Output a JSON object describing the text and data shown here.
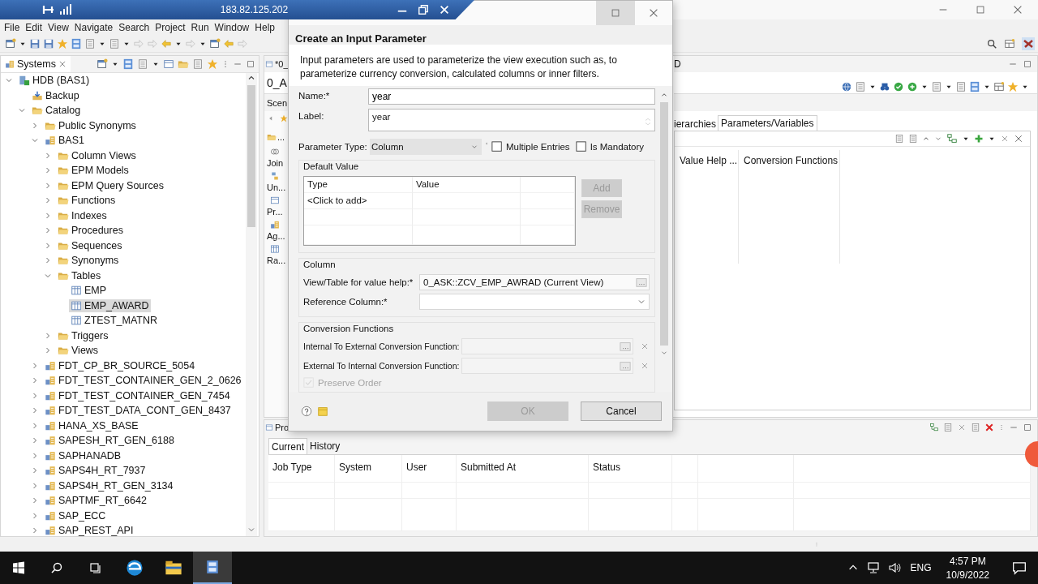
{
  "remote_bar": {
    "address": "183.82.125.202"
  },
  "menu": [
    "File",
    "Edit",
    "View",
    "Navigate",
    "Search",
    "Project",
    "Run",
    "Window",
    "Help"
  ],
  "systems_view": {
    "title": "Systems",
    "tree": [
      {
        "label": "HDB (BAS1)",
        "kind": "system",
        "expanded": true,
        "selected": false,
        "children": [
          {
            "label": "Backup",
            "kind": "backup",
            "selected": false
          },
          {
            "label": "Catalog",
            "kind": "folder",
            "expanded": true,
            "selected": false,
            "children": [
              {
                "label": "Public Synonyms",
                "kind": "folder",
                "expanded": false,
                "selected": false
              },
              {
                "label": "BAS1",
                "kind": "schema",
                "expanded": true,
                "selected": false,
                "children": [
                  {
                    "label": "Column Views",
                    "kind": "folder",
                    "expanded": false,
                    "selected": false
                  },
                  {
                    "label": "EPM Models",
                    "kind": "folder",
                    "expanded": false,
                    "selected": false
                  },
                  {
                    "label": "EPM Query Sources",
                    "kind": "folder",
                    "expanded": false,
                    "selected": false
                  },
                  {
                    "label": "Functions",
                    "kind": "folder",
                    "expanded": false,
                    "selected": false
                  },
                  {
                    "label": "Indexes",
                    "kind": "folder",
                    "expanded": false,
                    "selected": false
                  },
                  {
                    "label": "Procedures",
                    "kind": "folder",
                    "expanded": false,
                    "selected": false
                  },
                  {
                    "label": "Sequences",
                    "kind": "folder",
                    "expanded": false,
                    "selected": false
                  },
                  {
                    "label": "Synonyms",
                    "kind": "folder",
                    "expanded": false,
                    "selected": false
                  },
                  {
                    "label": "Tables",
                    "kind": "folder",
                    "expanded": true,
                    "selected": false,
                    "children": [
                      {
                        "label": "EMP",
                        "kind": "table",
                        "selected": false
                      },
                      {
                        "label": "EMP_AWARD",
                        "kind": "table",
                        "selected": true
                      },
                      {
                        "label": "ZTEST_MATNR",
                        "kind": "table",
                        "selected": false
                      }
                    ]
                  },
                  {
                    "label": "Triggers",
                    "kind": "folder",
                    "expanded": false,
                    "selected": false
                  },
                  {
                    "label": "Views",
                    "kind": "folder",
                    "expanded": false,
                    "selected": false
                  }
                ]
              },
              {
                "label": "FDT_CP_BR_SOURCE_5054",
                "kind": "schema",
                "expanded": false,
                "selected": false
              },
              {
                "label": "FDT_TEST_CONTAINER_GEN_2_0626",
                "kind": "schema",
                "expanded": false,
                "selected": false
              },
              {
                "label": "FDT_TEST_CONTAINER_GEN_7454",
                "kind": "schema",
                "expanded": false,
                "selected": false
              },
              {
                "label": "FDT_TEST_DATA_CONT_GEN_8437",
                "kind": "schema",
                "expanded": false,
                "selected": false
              },
              {
                "label": "HANA_XS_BASE",
                "kind": "schema",
                "expanded": false,
                "selected": false
              },
              {
                "label": "SAPESH_RT_GEN_6188",
                "kind": "schema",
                "expanded": false,
                "selected": false
              },
              {
                "label": "SAPHANADB",
                "kind": "schema",
                "expanded": false,
                "selected": false
              },
              {
                "label": "SAPS4H_RT_7937",
                "kind": "schema",
                "expanded": false,
                "selected": false
              },
              {
                "label": "SAPS4H_RT_GEN_3134",
                "kind": "schema",
                "expanded": false,
                "selected": false
              },
              {
                "label": "SAPTMF_RT_6642",
                "kind": "schema",
                "expanded": false,
                "selected": false
              },
              {
                "label": "SAP_ECC",
                "kind": "schema",
                "expanded": false,
                "selected": false
              },
              {
                "label": "SAP_REST_API",
                "kind": "schema",
                "expanded": false,
                "selected": false
              }
            ]
          }
        ]
      }
    ]
  },
  "editor": {
    "tab_title": "*0_",
    "tab_title_end": "D",
    "heading": "0_A",
    "scenario_label": "Scen",
    "palette_header": "...",
    "palette": [
      "Join",
      "Un...",
      "Pr...",
      "Ag...",
      "Ra..."
    ],
    "tabs": [
      {
        "label": "ierarchies",
        "selected": false
      },
      {
        "label": "Parameters/Variables",
        "selected": true
      }
    ],
    "columns": [
      "Value Help ...",
      "Conversion Functions"
    ]
  },
  "bottom_panel": {
    "title": "Pro",
    "tabs": [
      {
        "label": "Current",
        "selected": true
      },
      {
        "label": "History",
        "selected": false
      }
    ],
    "columns": [
      "Job Type",
      "System",
      "User",
      "Submitted At",
      "Status"
    ]
  },
  "dialog": {
    "heading": "Create an Input Parameter",
    "description": "Input parameters are used to parameterize the view execution such as, to parameterize currency conversion, calculated columns or inner filters.",
    "name": {
      "label": "Name:*",
      "value": "year"
    },
    "label": {
      "label": "Label:",
      "value": "year"
    },
    "parameter_type": {
      "label": "Parameter Type:",
      "value": "Column"
    },
    "multiple_entries": {
      "label": "Multiple Entries",
      "checked": false
    },
    "is_mandatory": {
      "label": "Is Mandatory",
      "checked": false
    },
    "default_value": {
      "title": "Default Value",
      "columns": [
        "Type",
        "Value"
      ],
      "rows": [
        "<Click to add>"
      ],
      "buttons": [
        {
          "label": "Add",
          "disabled": true
        },
        {
          "label": "Remove",
          "disabled": true
        }
      ]
    },
    "column_group": {
      "title": "Column",
      "value_help": {
        "label": "View/Table for value help:*",
        "value": "0_ASK::ZCV_EMP_AWRAD (Current View)"
      },
      "reference_column": {
        "label": "Reference Column:*"
      }
    },
    "conversion": {
      "title": "Conversion Functions",
      "fields": [
        {
          "label": "Internal To External Conversion Function:",
          "disabled": true
        },
        {
          "label": "External To Internal Conversion Function:",
          "disabled": true
        }
      ],
      "preserve_order": {
        "label": "Preserve Order",
        "checked": true,
        "disabled": true
      }
    },
    "buttons": [
      {
        "label": "OK",
        "disabled": true
      },
      {
        "label": "Cancel",
        "disabled": false
      }
    ]
  },
  "taskbar": {
    "language": "ENG",
    "time": "4:57 PM",
    "date": "10/9/2022"
  }
}
